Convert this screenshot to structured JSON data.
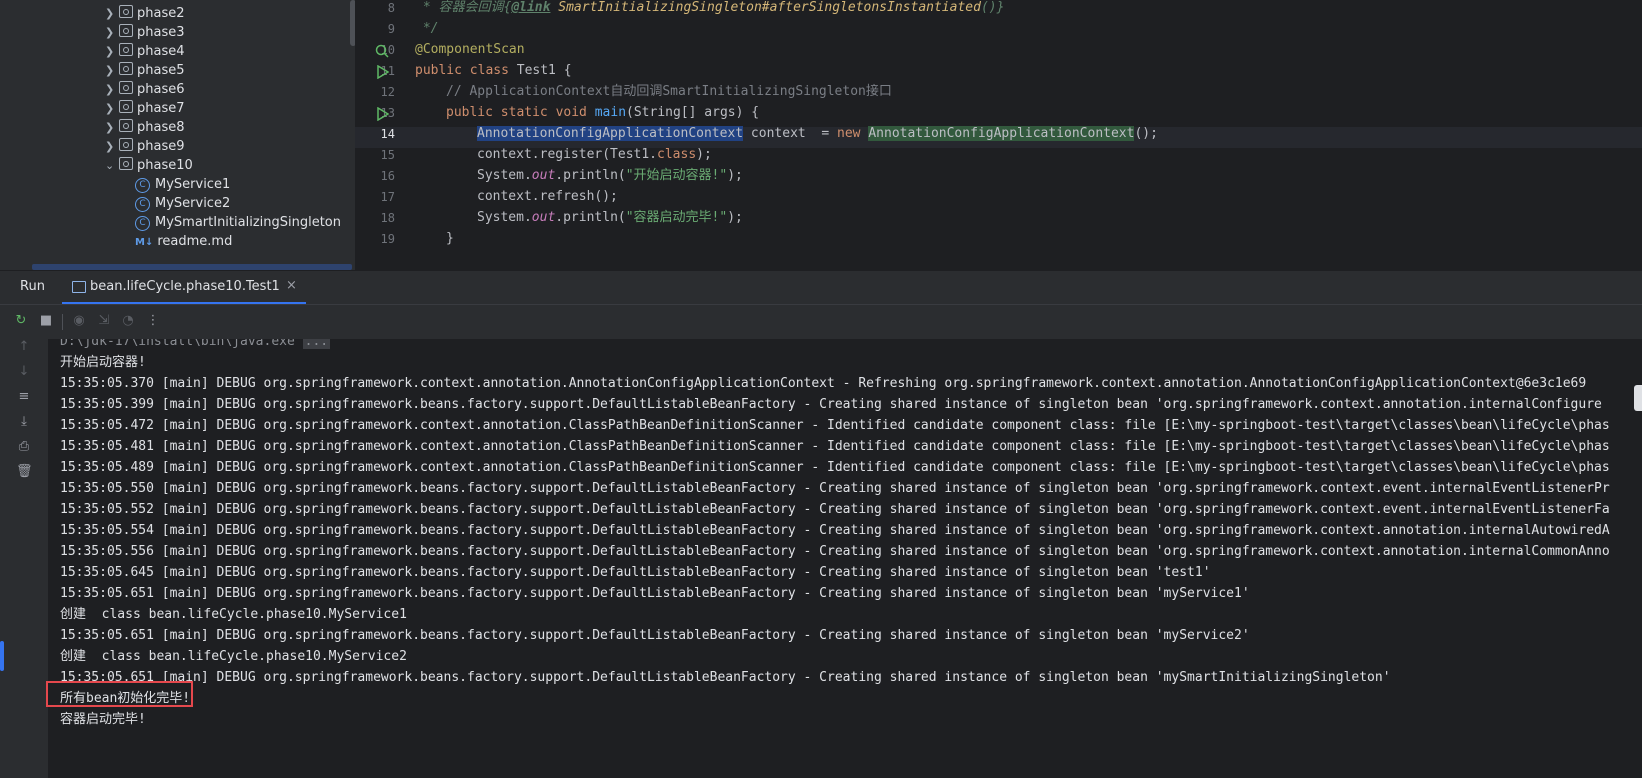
{
  "project_tree": {
    "items": [
      {
        "label": "phase2",
        "type": "package"
      },
      {
        "label": "phase3",
        "type": "package"
      },
      {
        "label": "phase4",
        "type": "package"
      },
      {
        "label": "phase5",
        "type": "package"
      },
      {
        "label": "phase6",
        "type": "package"
      },
      {
        "label": "phase7",
        "type": "package"
      },
      {
        "label": "phase8",
        "type": "package"
      },
      {
        "label": "phase9",
        "type": "package"
      },
      {
        "label": "phase10",
        "type": "package-expanded"
      },
      {
        "label": "MyService1",
        "type": "class"
      },
      {
        "label": "MyService2",
        "type": "class"
      },
      {
        "label": "MySmartInitializingSingleton",
        "type": "class"
      },
      {
        "label": "readme.md",
        "type": "markdown"
      }
    ]
  },
  "editor": {
    "lines": [
      {
        "num": "8"
      },
      {
        "num": "9"
      },
      {
        "num": "10"
      },
      {
        "num": "11"
      },
      {
        "num": "12"
      },
      {
        "num": "13"
      },
      {
        "num": "14"
      },
      {
        "num": "15"
      },
      {
        "num": "16"
      },
      {
        "num": "17"
      },
      {
        "num": "18"
      },
      {
        "num": "19"
      }
    ],
    "code": {
      "l8_prefix": " * 容器会回调{",
      "l8_link": "@link",
      "l8_ref": " SmartInitializingSingleton",
      "l8_method": "#afterSingletonsInstantiated",
      "l8_suffix": "()}",
      "l9": " */",
      "l10": "@ComponentScan",
      "l11_kw": "public class",
      "l11_rest": " Test1 {",
      "l12": "// ApplicationContext自动回调SmartInitializingSingleton接口",
      "l13_kw": "public static void",
      "l13_fn": "main",
      "l13_rest": "(String[] args) {",
      "l14_type": "AnnotationConfigApplicationContext",
      "l14_mid": " context  = ",
      "l14_new": "new",
      "l14_ctor": "AnnotationConfigApplicationContext",
      "l14_end": "();",
      "l15_a": "context.register(Test1.",
      "l15_kw": "class",
      "l15_b": ");",
      "l16_a": "System.",
      "l16_st": "out",
      "l16_b": ".println(",
      "l16_str": "\"开始启动容器!\"",
      "l16_c": ");",
      "l17": "context.refresh();",
      "l18_a": "System.",
      "l18_st": "out",
      "l18_b": ".println(",
      "l18_str": "\"容器启动完毕!\"",
      "l18_c": ");",
      "l19": "}"
    }
  },
  "run_panel": {
    "title": "Run",
    "tab_label": "bean.lifeCycle.phase10.Test1",
    "tab_close": "×"
  },
  "console": {
    "path_line": "D:\\jdk-17\\install\\bin\\java.exe",
    "path_dots": "...",
    "lines": [
      "开始启动容器!",
      "15:35:05.370 [main] DEBUG org.springframework.context.annotation.AnnotationConfigApplicationContext - Refreshing org.springframework.context.annotation.AnnotationConfigApplicationContext@6e3c1e69",
      "15:35:05.399 [main] DEBUG org.springframework.beans.factory.support.DefaultListableBeanFactory - Creating shared instance of singleton bean 'org.springframework.context.annotation.internalConfigure",
      "15:35:05.472 [main] DEBUG org.springframework.context.annotation.ClassPathBeanDefinitionScanner - Identified candidate component class: file [E:\\my-springboot-test\\target\\classes\\bean\\lifeCycle\\phas",
      "15:35:05.481 [main] DEBUG org.springframework.context.annotation.ClassPathBeanDefinitionScanner - Identified candidate component class: file [E:\\my-springboot-test\\target\\classes\\bean\\lifeCycle\\phas",
      "15:35:05.489 [main] DEBUG org.springframework.context.annotation.ClassPathBeanDefinitionScanner - Identified candidate component class: file [E:\\my-springboot-test\\target\\classes\\bean\\lifeCycle\\phas",
      "15:35:05.550 [main] DEBUG org.springframework.beans.factory.support.DefaultListableBeanFactory - Creating shared instance of singleton bean 'org.springframework.context.event.internalEventListenerPr",
      "15:35:05.552 [main] DEBUG org.springframework.beans.factory.support.DefaultListableBeanFactory - Creating shared instance of singleton bean 'org.springframework.context.event.internalEventListenerFa",
      "15:35:05.554 [main] DEBUG org.springframework.beans.factory.support.DefaultListableBeanFactory - Creating shared instance of singleton bean 'org.springframework.context.annotation.internalAutowiredA",
      "15:35:05.556 [main] DEBUG org.springframework.beans.factory.support.DefaultListableBeanFactory - Creating shared instance of singleton bean 'org.springframework.context.annotation.internalCommonAnno",
      "15:35:05.645 [main] DEBUG org.springframework.beans.factory.support.DefaultListableBeanFactory - Creating shared instance of singleton bean 'test1'",
      "15:35:05.651 [main] DEBUG org.springframework.beans.factory.support.DefaultListableBeanFactory - Creating shared instance of singleton bean 'myService1'",
      "创建  class bean.lifeCycle.phase10.MyService1",
      "15:35:05.651 [main] DEBUG org.springframework.beans.factory.support.DefaultListableBeanFactory - Creating shared instance of singleton bean 'myService2'",
      "创建  class bean.lifeCycle.phase10.MyService2",
      "15:35:05.651 [main] DEBUG org.springframework.beans.factory.support.DefaultListableBeanFactory - Creating shared instance of singleton bean 'mySmartInitializingSingleton'",
      "所有bean初始化完毕!",
      "容器启动完毕!"
    ]
  },
  "colors": {
    "accent": "#3574f0",
    "highlight_box": "#e5484d"
  }
}
